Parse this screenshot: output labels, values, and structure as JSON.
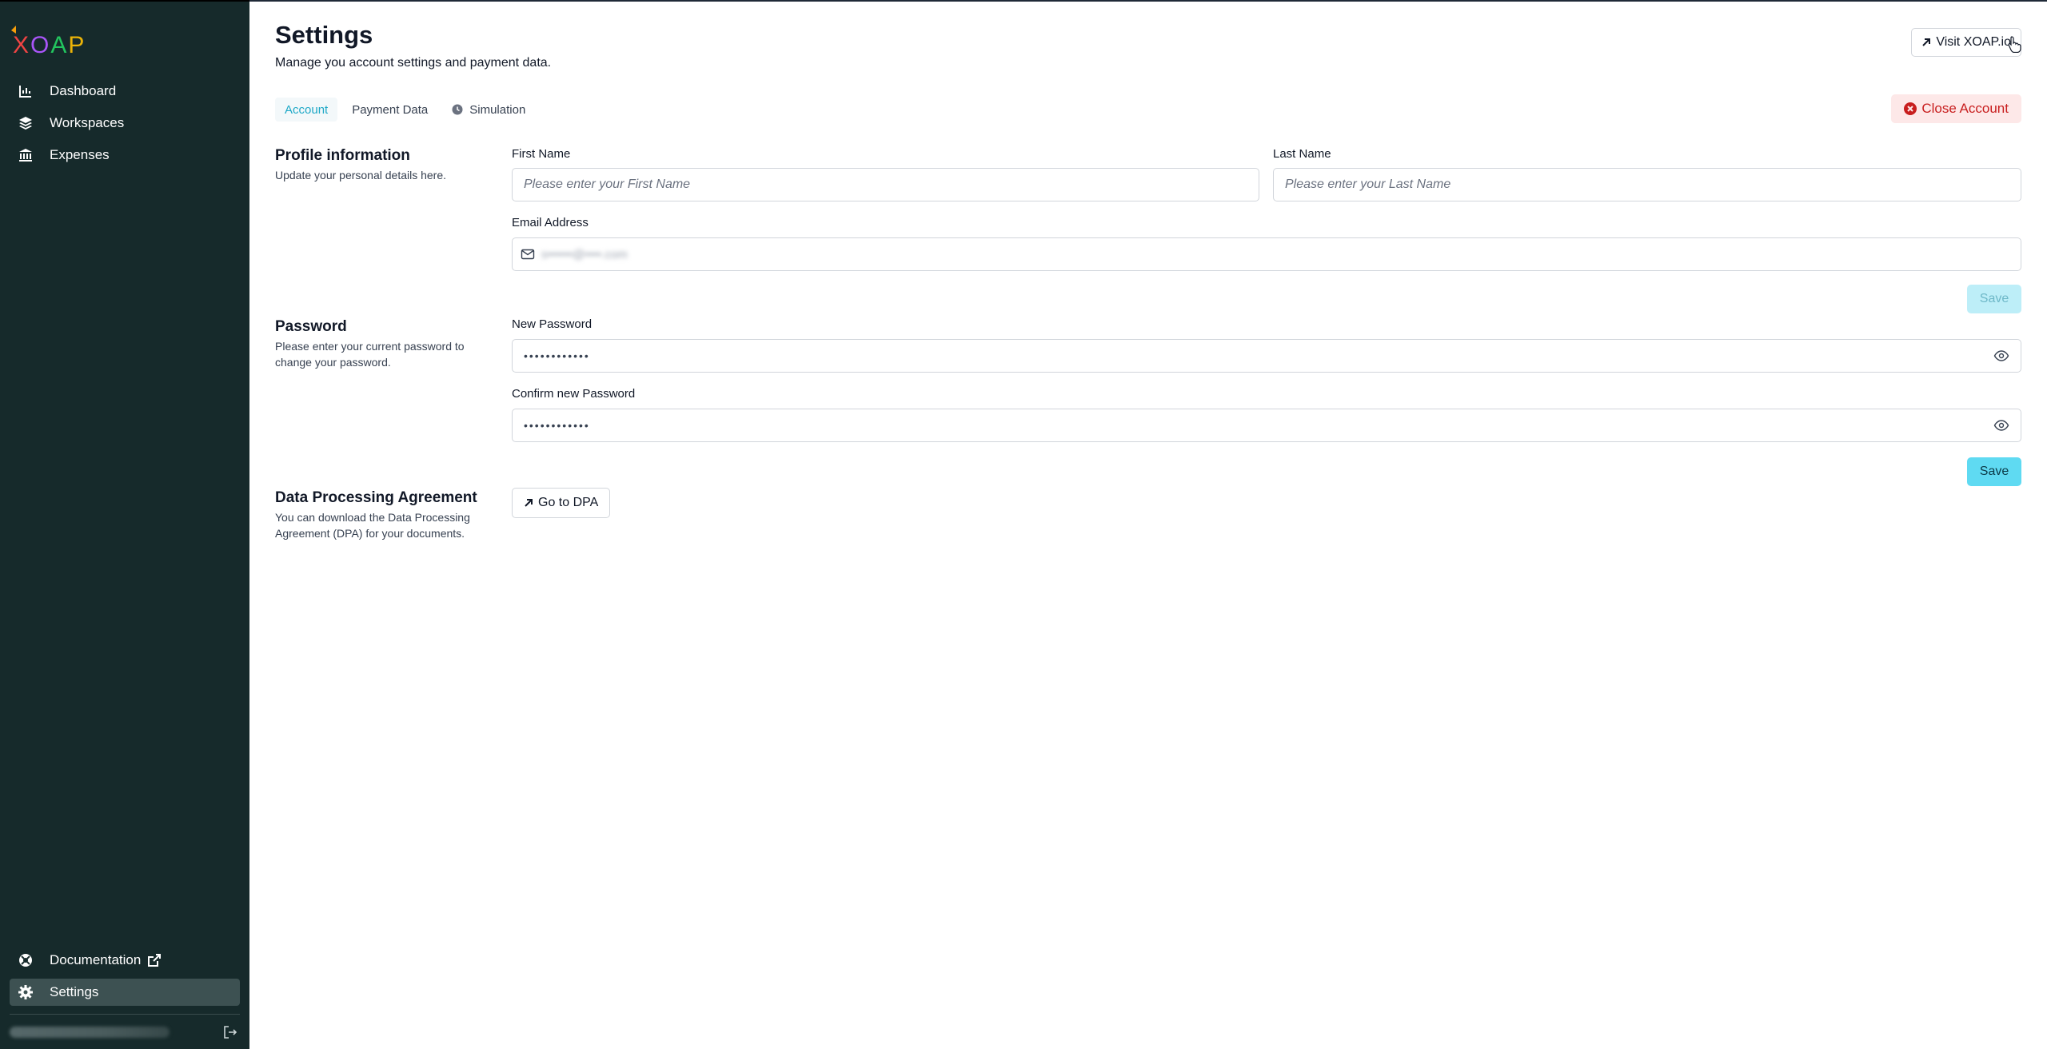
{
  "app": {
    "logo_text": "XOAP"
  },
  "sidebar": {
    "items": [
      {
        "label": "Dashboard",
        "icon": "chart-icon"
      },
      {
        "label": "Workspaces",
        "icon": "layers-icon"
      },
      {
        "label": "Expenses",
        "icon": "bank-icon"
      }
    ],
    "bottom_items": [
      {
        "label": "Documentation",
        "icon": "help-circle-icon",
        "external": true
      },
      {
        "label": "Settings",
        "icon": "gear-icon",
        "active": true
      }
    ],
    "logout_icon": "logout-icon"
  },
  "header": {
    "title": "Settings",
    "subtitle": "Manage you account settings and payment data.",
    "visit_label": "Visit XOAP.io"
  },
  "tabs": [
    {
      "label": "Account",
      "active": true
    },
    {
      "label": "Payment Data",
      "active": false
    },
    {
      "label": "Simulation",
      "active": false,
      "icon": "clock-icon"
    }
  ],
  "close_account_label": "Close Account",
  "profile": {
    "title": "Profile information",
    "description": "Update your personal details here.",
    "first_name_label": "First Name",
    "first_name_placeholder": "Please enter your First Name",
    "last_name_label": "Last Name",
    "last_name_placeholder": "Please enter your Last Name",
    "email_label": "Email Address",
    "email_value_redacted": "s••••••@••••.com",
    "save_label": "Save"
  },
  "password": {
    "title": "Password",
    "description": "Please enter your current password to change your password.",
    "new_label": "New Password",
    "new_value": "••••••••••••",
    "confirm_label": "Confirm new Password",
    "confirm_value": "••••••••••••",
    "save_label": "Save"
  },
  "dpa": {
    "title": "Data Processing Agreement",
    "description": "You can download the Data Processing Agreement (DPA) for your documents.",
    "button_label": "Go to DPA"
  },
  "colors": {
    "sidebar_bg": "#162a2b",
    "accent": "#5fdaf2",
    "danger": "#c81e1e"
  }
}
